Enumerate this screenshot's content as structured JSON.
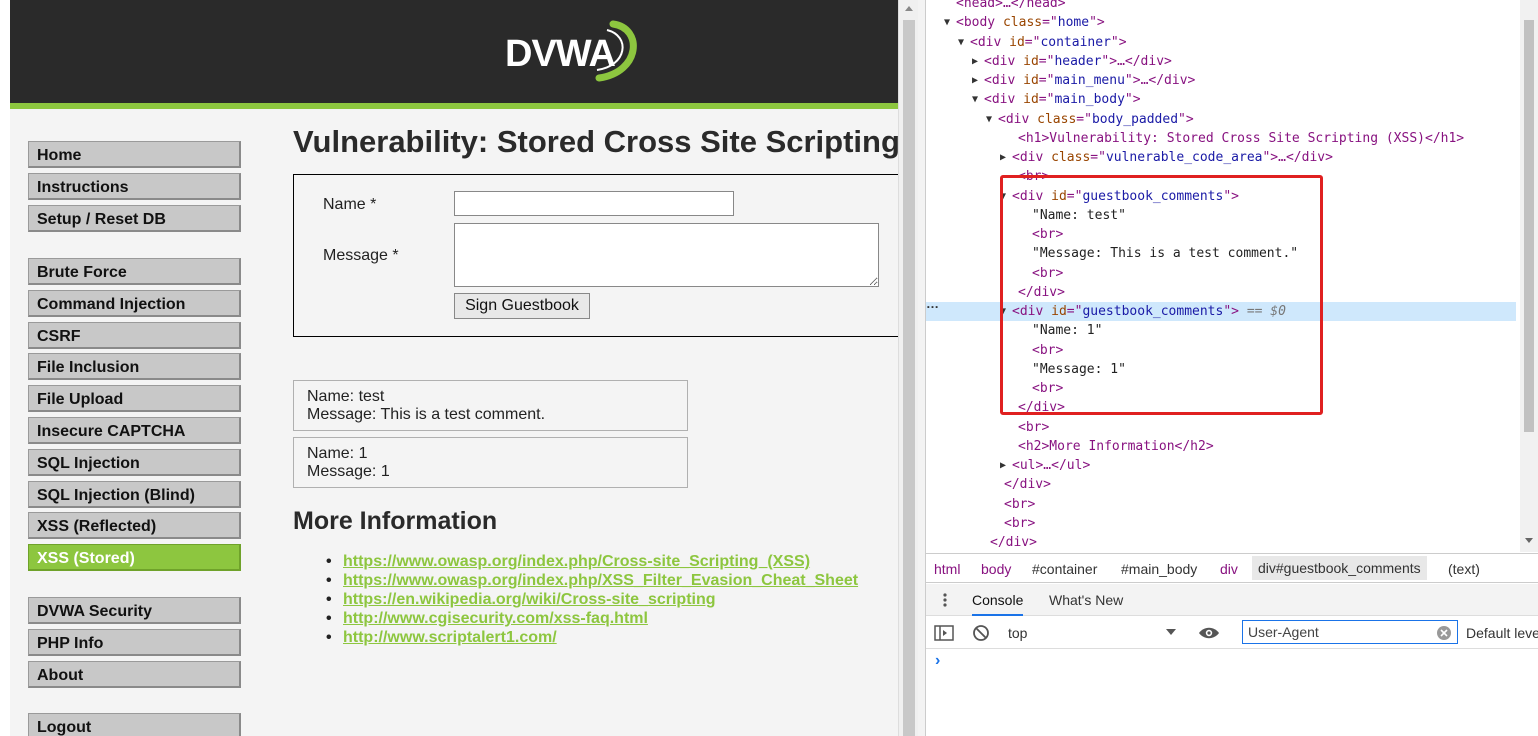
{
  "logo": {
    "text": "DVWA"
  },
  "menu": {
    "group1": [
      "Home",
      "Instructions",
      "Setup / Reset DB"
    ],
    "group2": [
      "Brute Force",
      "Command Injection",
      "CSRF",
      "File Inclusion",
      "File Upload",
      "Insecure CAPTCHA",
      "SQL Injection",
      "SQL Injection (Blind)",
      "XSS (Reflected)",
      "XSS (Stored)"
    ],
    "group3": [
      "DVWA Security",
      "PHP Info",
      "About"
    ],
    "group4": [
      "Logout"
    ],
    "active": "XSS (Stored)"
  },
  "main": {
    "title": "Vulnerability: Stored Cross Site Scripting (XSS)",
    "form": {
      "name_label": "Name *",
      "message_label": "Message *",
      "name_value": "",
      "message_value": "",
      "submit_label": "Sign Guestbook"
    },
    "comments": [
      {
        "name": "Name: test",
        "message": "Message: This is a test comment."
      },
      {
        "name": "Name: 1",
        "message": "Message: 1"
      }
    ],
    "more_info_title": "More Information",
    "links": [
      "https://www.owasp.org/index.php/Cross-site_Scripting_(XSS)",
      "https://www.owasp.org/index.php/XSS_Filter_Evasion_Cheat_Sheet",
      "https://en.wikipedia.org/wiki/Cross-site_scripting",
      "http://www.cgisecurity.com/xss-faq.html",
      "http://www.scriptalert1.com/"
    ]
  },
  "devtools": {
    "elements": [
      {
        "text": "<head>…</head>"
      },
      {
        "tri": "▼",
        "tag": "body",
        "attr": "class",
        "val": "home"
      },
      {
        "tri": "▼",
        "tag": "div",
        "attr": "id",
        "val": "container"
      },
      {
        "tri": "▶",
        "tag": "div",
        "attr": "id",
        "val": "header",
        "tail": "…</div>"
      },
      {
        "tri": "▶",
        "tag": "div",
        "attr": "id",
        "val": "main_menu",
        "tail": "…</div>"
      },
      {
        "tri": "▼",
        "tag": "div",
        "attr": "id",
        "val": "main_body"
      },
      {
        "tri": "▼",
        "tag": "div",
        "attr": "class",
        "val": "body_padded"
      },
      {
        "text": "<h1>Vulnerability: Stored Cross Site Scripting (XSS)</h1>"
      },
      {
        "tri": "▶",
        "tag": "div",
        "attr": "class",
        "val": "vulnerable_code_area",
        "tail": "…</div>"
      },
      {
        "text": "<br>"
      },
      {
        "tri": "▼",
        "tag": "div",
        "attr": "id",
        "val": "guestbook_comments"
      },
      {
        "text": "\"Name: test\""
      },
      {
        "text": "<br>"
      },
      {
        "text": "\"Message: This is a test comment.\""
      },
      {
        "text": "<br>"
      },
      {
        "text": "</div>"
      },
      {
        "tri": "▼",
        "tag": "div",
        "attr": "id",
        "val": "guestbook_comments",
        "suffix": " == $0"
      },
      {
        "text": "\"Name: 1\""
      },
      {
        "text": "<br>"
      },
      {
        "text": "\"Message: 1\""
      },
      {
        "text": "<br>"
      },
      {
        "text": "</div>"
      },
      {
        "text": "<br>"
      },
      {
        "text": "<h2>More Information</h2>"
      },
      {
        "tri": "▶",
        "text": "<ul>…</ul>"
      },
      {
        "text": "</div>"
      },
      {
        "text": "<br>"
      },
      {
        "text": "<br>"
      },
      {
        "text": "</div>"
      }
    ],
    "ellipsis": "…",
    "breadcrumbs": [
      "html",
      "body",
      "#container",
      "#main_body",
      "div",
      "div#guestbook_comments",
      "(text)"
    ],
    "drawer_tabs": {
      "console": "Console",
      "whats_new": "What's New"
    },
    "context": "top",
    "filter_value": "User-Agent",
    "levels": "Default levels"
  }
}
